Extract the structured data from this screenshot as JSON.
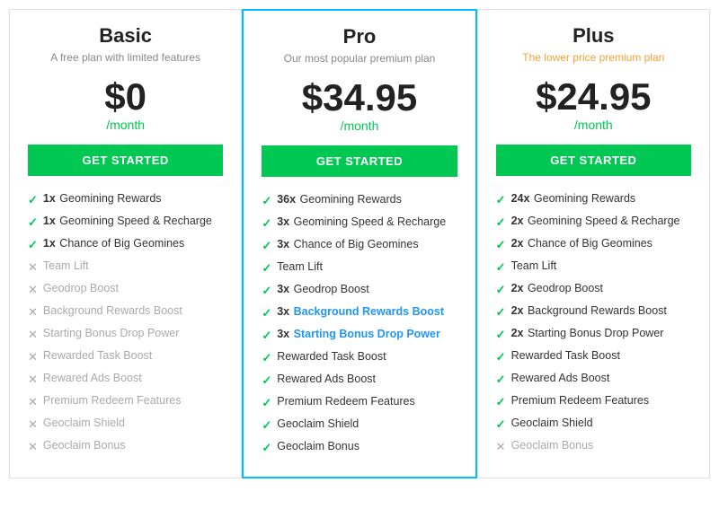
{
  "plans": [
    {
      "id": "basic",
      "name": "Basic",
      "subtitle": "A free plan with limited features",
      "subtitle_color": "gray",
      "price": "$0",
      "period": "/month",
      "cta": "GET STARTED",
      "featured": false,
      "features": [
        {
          "icon": "check",
          "multiplier": "1x",
          "text": "Geomining Rewards",
          "bold": false
        },
        {
          "icon": "check",
          "multiplier": "1x",
          "text": "Geomining Speed & Recharge",
          "bold": false
        },
        {
          "icon": "check",
          "multiplier": "1x",
          "text": "Chance of Big Geomines",
          "bold": false
        },
        {
          "icon": "cross",
          "multiplier": "",
          "text": "Team Lift",
          "bold": false
        },
        {
          "icon": "cross",
          "multiplier": "",
          "text": "Geodrop Boost",
          "bold": false
        },
        {
          "icon": "cross",
          "multiplier": "",
          "text": "Background Rewards Boost",
          "bold": false
        },
        {
          "icon": "cross",
          "multiplier": "",
          "text": "Starting Bonus Drop Power",
          "bold": false
        },
        {
          "icon": "cross",
          "multiplier": "",
          "text": "Rewarded Task Boost",
          "bold": false
        },
        {
          "icon": "cross",
          "multiplier": "",
          "text": "Rewared Ads Boost",
          "bold": false
        },
        {
          "icon": "cross",
          "multiplier": "",
          "text": "Premium Redeem Features",
          "bold": false
        },
        {
          "icon": "cross",
          "multiplier": "",
          "text": "Geoclaim Shield",
          "bold": false
        },
        {
          "icon": "cross",
          "multiplier": "",
          "text": "Geoclaim Bonus",
          "bold": false
        }
      ]
    },
    {
      "id": "pro",
      "name": "Pro",
      "subtitle": "Our most popular premium plan",
      "subtitle_color": "gray",
      "price": "$34.95",
      "period": "/month",
      "cta": "GET STARTED",
      "featured": true,
      "features": [
        {
          "icon": "check",
          "multiplier": "36x",
          "text": "Geomining Rewards",
          "bold": false
        },
        {
          "icon": "check",
          "multiplier": "3x",
          "text": "Geomining Speed & Recharge",
          "bold": false
        },
        {
          "icon": "check",
          "multiplier": "3x",
          "text": "Chance of Big Geomines",
          "bold": false
        },
        {
          "icon": "check",
          "multiplier": "",
          "text": "Team Lift",
          "bold": false
        },
        {
          "icon": "check",
          "multiplier": "3x",
          "text": "Geodrop Boost",
          "bold": false
        },
        {
          "icon": "check",
          "multiplier": "3x",
          "text": "Background Rewards Boost",
          "bold": true
        },
        {
          "icon": "check",
          "multiplier": "3x",
          "text": "Starting Bonus Drop Power",
          "bold": true
        },
        {
          "icon": "check",
          "multiplier": "",
          "text": "Rewarded Task Boost",
          "bold": false
        },
        {
          "icon": "check",
          "multiplier": "",
          "text": "Rewared Ads Boost",
          "bold": false
        },
        {
          "icon": "check",
          "multiplier": "",
          "text": "Premium Redeem Features",
          "bold": false
        },
        {
          "icon": "check",
          "multiplier": "",
          "text": "Geoclaim Shield",
          "bold": false
        },
        {
          "icon": "check",
          "multiplier": "",
          "text": "Geoclaim Bonus",
          "bold": false
        }
      ]
    },
    {
      "id": "plus",
      "name": "Plus",
      "subtitle": "The lower price premium plan",
      "subtitle_color": "orange",
      "price": "$24.95",
      "period": "/month",
      "cta": "GET STARTED",
      "featured": false,
      "features": [
        {
          "icon": "check",
          "multiplier": "24x",
          "text": "Geomining Rewards",
          "bold": false
        },
        {
          "icon": "check",
          "multiplier": "2x",
          "text": "Geomining Speed & Recharge",
          "bold": false
        },
        {
          "icon": "check",
          "multiplier": "2x",
          "text": "Chance of Big Geomines",
          "bold": false
        },
        {
          "icon": "check",
          "multiplier": "",
          "text": "Team Lift",
          "bold": false
        },
        {
          "icon": "check",
          "multiplier": "2x",
          "text": "Geodrop Boost",
          "bold": false
        },
        {
          "icon": "check",
          "multiplier": "2x",
          "text": "Background Rewards Boost",
          "bold": false
        },
        {
          "icon": "check",
          "multiplier": "2x",
          "text": "Starting Bonus Drop Power",
          "bold": false
        },
        {
          "icon": "check",
          "multiplier": "",
          "text": "Rewarded Task Boost",
          "bold": false
        },
        {
          "icon": "check",
          "multiplier": "",
          "text": "Rewared Ads Boost",
          "bold": false
        },
        {
          "icon": "check",
          "multiplier": "",
          "text": "Premium Redeem Features",
          "bold": false
        },
        {
          "icon": "check",
          "multiplier": "",
          "text": "Geoclaim Shield",
          "bold": false
        },
        {
          "icon": "cross",
          "multiplier": "",
          "text": "Geoclaim Bonus",
          "bold": false
        }
      ]
    }
  ]
}
